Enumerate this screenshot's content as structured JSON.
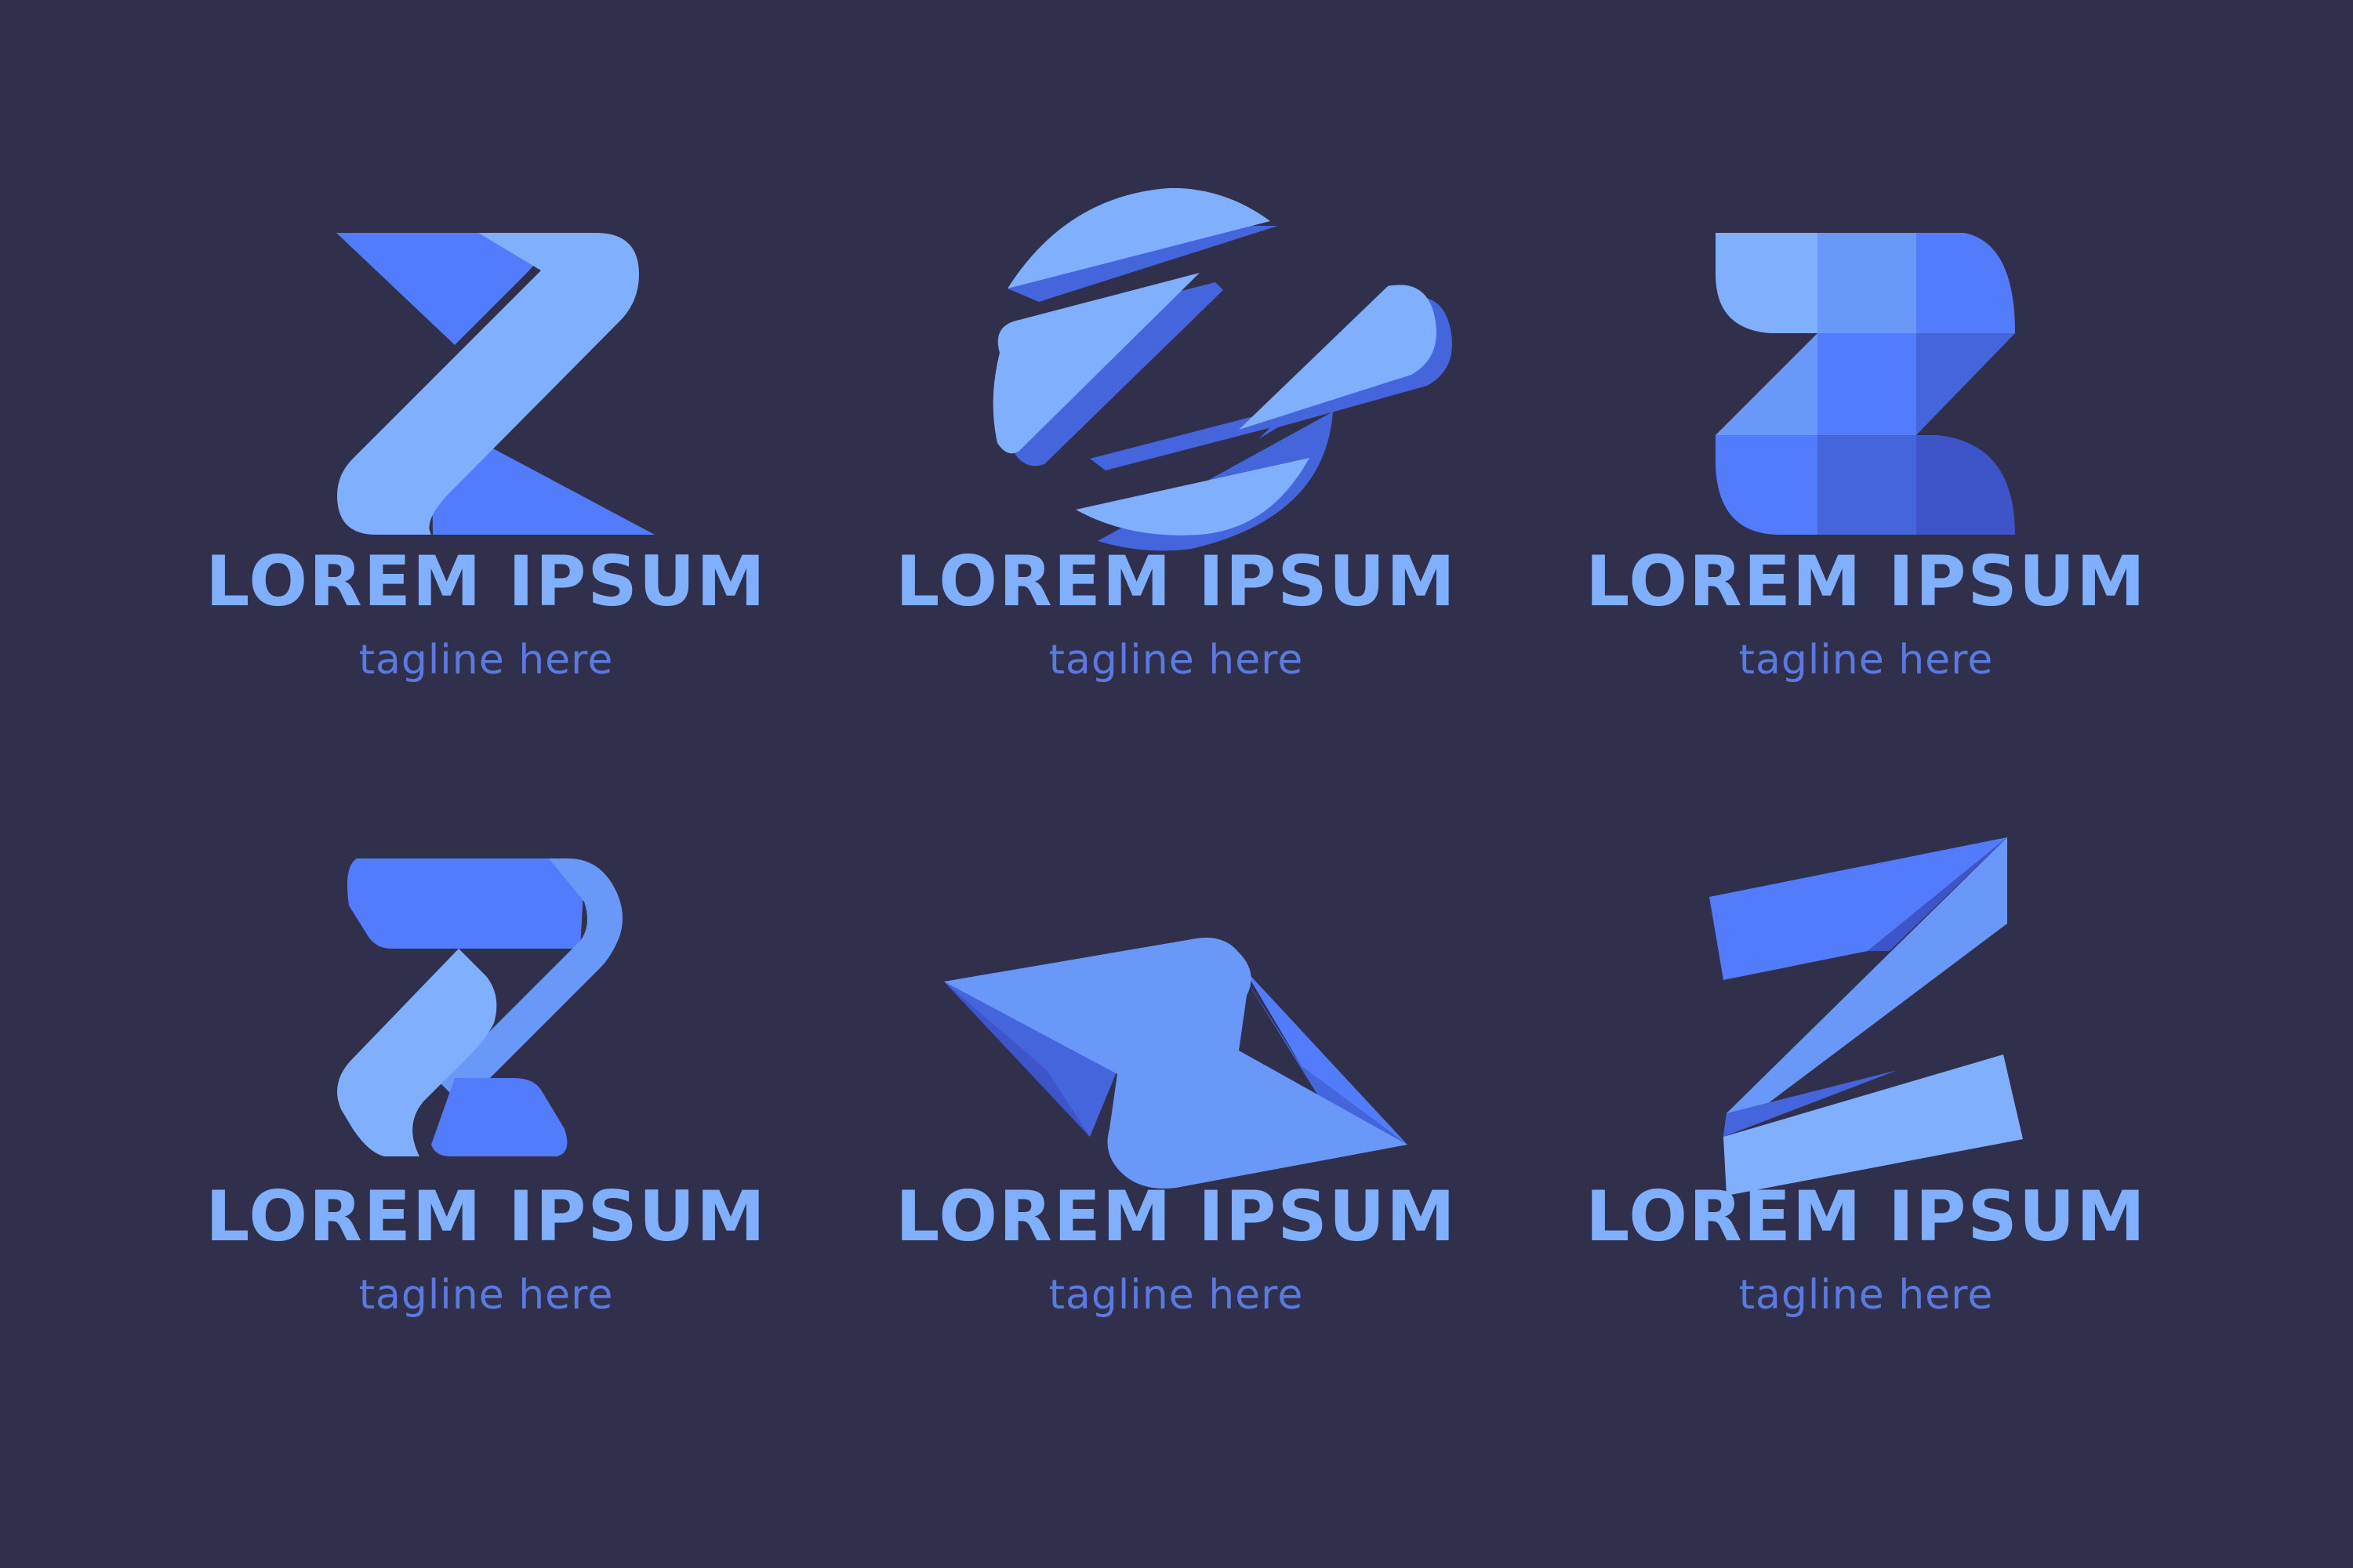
{
  "colors": {
    "background": "#30304d",
    "light_blue": "#80b0fd",
    "mid_blue": "#6a98f8",
    "blue": "#537cfd",
    "dark_blue": "#4465dc",
    "deep_blue": "#3d55c8",
    "tagline": "#5a7ae0"
  },
  "logos": [
    {
      "icon": "ribbon-z-logo-icon",
      "brand": "LOREM IPSUM",
      "tagline": "tagline here"
    },
    {
      "icon": "circle-z-logo-icon",
      "brand": "LOREM IPSUM",
      "tagline": "tagline here"
    },
    {
      "icon": "block-z-logo-icon",
      "brand": "LOREM IPSUM",
      "tagline": "tagline here"
    },
    {
      "icon": "rounded-z-logo-icon",
      "brand": "LOREM IPSUM",
      "tagline": "tagline here"
    },
    {
      "icon": "folded-z-logo-icon",
      "brand": "LOREM IPSUM",
      "tagline": "tagline here"
    },
    {
      "icon": "paper-z-logo-icon",
      "brand": "LOREM IPSUM",
      "tagline": "tagline here"
    }
  ]
}
